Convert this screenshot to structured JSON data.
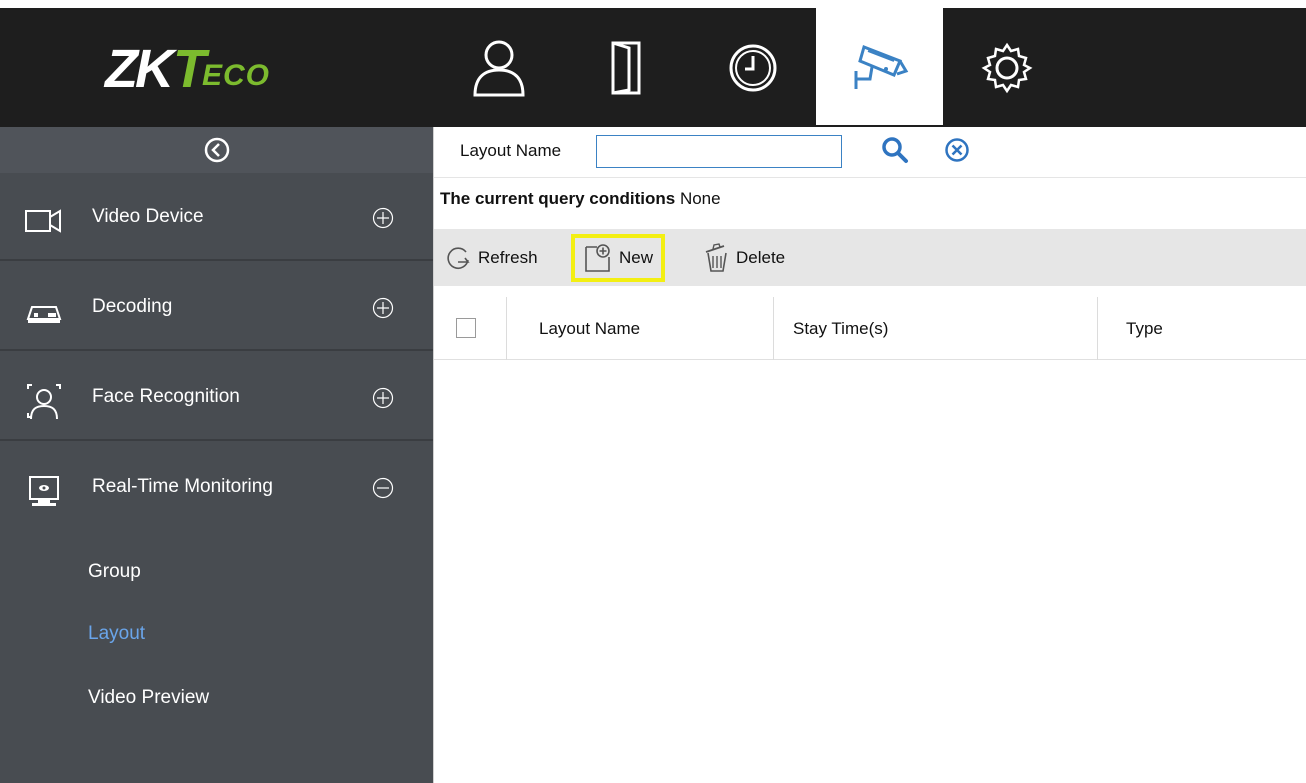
{
  "brand": {
    "logo_main": "ZK",
    "logo_t": "T",
    "logo_eco": "ECO"
  },
  "topnav": [
    {
      "icon": "person-icon"
    },
    {
      "icon": "door-icon"
    },
    {
      "icon": "clock-icon"
    },
    {
      "icon": "camera-icon",
      "active": true
    },
    {
      "icon": "gear-icon"
    }
  ],
  "sidebar": {
    "sections": [
      {
        "label": "Video Device",
        "icon": "video-camera-icon",
        "expanded": false
      },
      {
        "label": "Decoding",
        "icon": "decoder-icon",
        "expanded": false
      },
      {
        "label": "Face Recognition",
        "icon": "face-scan-icon",
        "expanded": false
      },
      {
        "label": "Real-Time Monitoring",
        "icon": "monitor-icon",
        "expanded": true
      }
    ],
    "subitems": [
      {
        "label": "Group",
        "active": false
      },
      {
        "label": "Layout",
        "active": true
      },
      {
        "label": "Video Preview",
        "active": false
      }
    ]
  },
  "search": {
    "label": "Layout Name",
    "value": ""
  },
  "query": {
    "label": "The current query conditions",
    "value": "None"
  },
  "toolbar": {
    "refresh_label": "Refresh",
    "new_label": "New",
    "delete_label": "Delete"
  },
  "table": {
    "columns": [
      "Layout Name",
      "Stay Time(s)",
      "Type"
    ],
    "rows": []
  },
  "colors": {
    "topbar_bg": "#1e1e1e",
    "sidebar_bg": "#484c51",
    "accent_blue": "#3b82c4",
    "active_link": "#6aa5ea",
    "brand_green": "#7cbb2e",
    "highlight_yellow": "#f3ef12"
  }
}
